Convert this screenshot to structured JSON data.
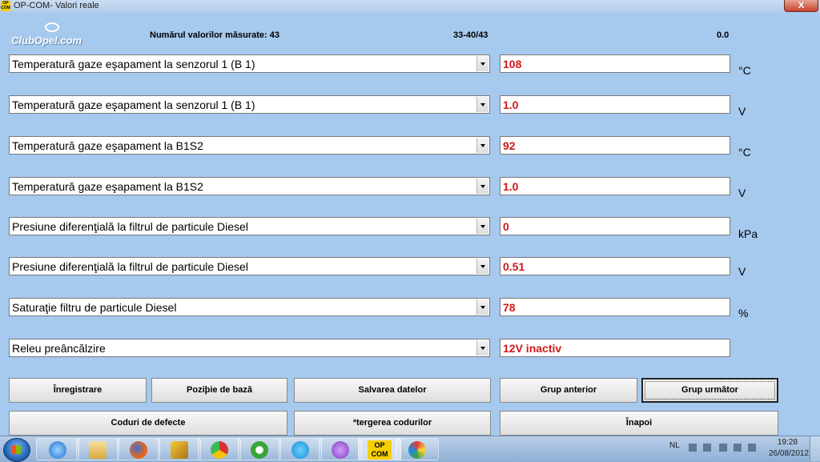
{
  "window": {
    "title": "OP-COM- Valori reale",
    "icon_text": "OP COM",
    "close_label": "X"
  },
  "logo": {
    "text": "ClubOpel.com"
  },
  "info": {
    "measured_label": "Numărul valorilor măsurate: 43",
    "range": "33-40/43",
    "value": "0.0"
  },
  "rows": [
    {
      "label": "Temperatură gaze eşapament la senzorul 1 (B 1)",
      "value": "108",
      "unit": "°C"
    },
    {
      "label": "Temperatură gaze eşapament la senzorul 1 (B 1)",
      "value": "1.0",
      "unit": "V"
    },
    {
      "label": "Temperatură gaze eşapament la B1S2",
      "value": "92",
      "unit": "°C"
    },
    {
      "label": "Temperatură gaze eşapament la B1S2",
      "value": "1.0",
      "unit": "V"
    },
    {
      "label": "Presiune diferenţială la filtrul de particule Diesel",
      "value": "0",
      "unit": "kPa"
    },
    {
      "label": "Presiune diferenţială la filtrul de particule Diesel",
      "value": "0.51",
      "unit": "V"
    },
    {
      "label": "Saturaţie filtru de particule Diesel",
      "value": "78",
      "unit": "%"
    },
    {
      "label": "Releu preâncălzire",
      "value": "12V inactiv",
      "unit": ""
    }
  ],
  "buttons": {
    "record": "Înregistrare",
    "base_position": "Poziþie de bază",
    "save_data": "Salvarea datelor",
    "prev_group": "Grup anterior",
    "next_group": "Grup următor",
    "fault_codes": "Coduri de defecte",
    "clear_codes": "ªtergerea codurilor",
    "back": "Înapoi"
  },
  "taskbar": {
    "items": [
      "internet-explorer-icon",
      "file-explorer-icon",
      "firefox-icon",
      "winamp-icon",
      "chrome-icon",
      "utorrent-icon",
      "skype-icon",
      "messenger-icon",
      "opcom-icon",
      "paint-icon"
    ],
    "opcom_label": "OP COM",
    "language": "NL",
    "time": "19:28",
    "date": "26/08/2012"
  },
  "colors": {
    "background": "#a6c9ee",
    "value_text": "#d01818"
  }
}
